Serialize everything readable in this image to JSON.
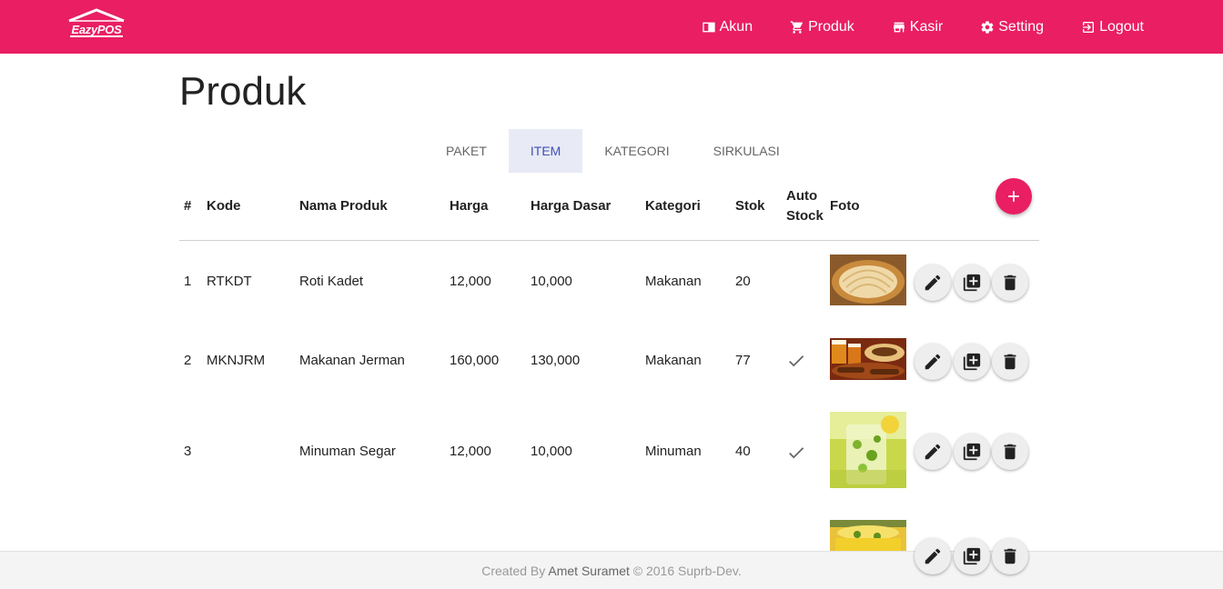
{
  "nav": {
    "brand": "EazyPOS",
    "items": [
      {
        "label": "Akun",
        "icon": "account-card-icon"
      },
      {
        "label": "Produk",
        "icon": "cart-icon"
      },
      {
        "label": "Kasir",
        "icon": "store-icon"
      },
      {
        "label": "Setting",
        "icon": "gear-icon"
      },
      {
        "label": "Logout",
        "icon": "logout-icon"
      }
    ]
  },
  "page": {
    "title": "Produk"
  },
  "tabs": [
    {
      "label": "PAKET",
      "active": false
    },
    {
      "label": "ITEM",
      "active": true
    },
    {
      "label": "KATEGORI",
      "active": false
    },
    {
      "label": "SIRKULASI",
      "active": false
    }
  ],
  "table": {
    "headers": {
      "no": "#",
      "kode": "Kode",
      "nama": "Nama Produk",
      "harga": "Harga",
      "harga_dasar": "Harga Dasar",
      "kategori": "Kategori",
      "stok": "Stok",
      "auto_stock_1": "Auto",
      "auto_stock_2": "Stock",
      "foto": "Foto"
    },
    "rows": [
      {
        "no": "1",
        "kode": "RTKDT",
        "nama": "Roti Kadet",
        "harga": "12,000",
        "harga_dasar": "10,000",
        "kategori": "Makanan",
        "stok": "20",
        "auto_stock": false
      },
      {
        "no": "2",
        "kode": "MKNJRM",
        "nama": "Makanan Jerman",
        "harga": "160,000",
        "harga_dasar": "130,000",
        "kategori": "Makanan",
        "stok": "77",
        "auto_stock": true
      },
      {
        "no": "3",
        "kode": "",
        "nama": "Minuman Segar",
        "harga": "12,000",
        "harga_dasar": "10,000",
        "kategori": "Minuman",
        "stok": "40",
        "auto_stock": true
      }
    ]
  },
  "footer": {
    "prefix": "Created By",
    "author": "Amet Suramet",
    "suffix": "© 2016 Suprb-Dev."
  },
  "colors": {
    "primary": "#e91e63",
    "tab_active_bg": "#e8eaf6",
    "tab_active_text": "#3f51b5"
  }
}
